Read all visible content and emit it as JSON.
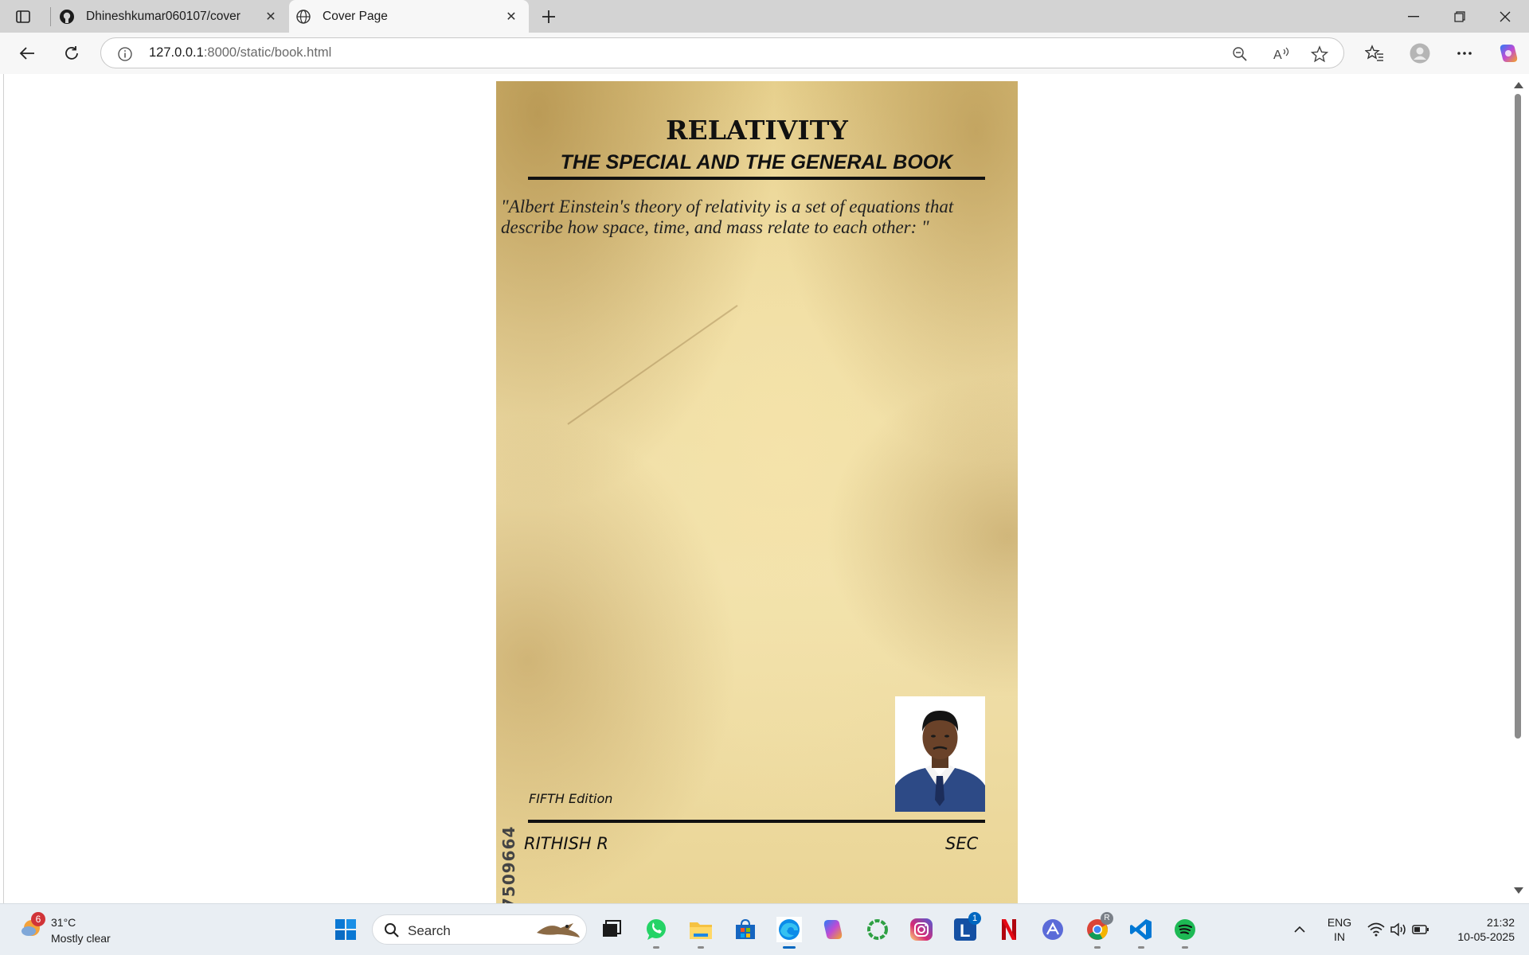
{
  "browser": {
    "tabs": [
      {
        "title": "Dhineshkumar060107/cover",
        "active": false
      },
      {
        "title": "Cover Page",
        "active": true
      }
    ],
    "address": {
      "host": "127.0.0.1",
      "rest": ":8000/static/book.html"
    }
  },
  "book": {
    "title": "RELATIVITY",
    "subtitle": "THE SPECIAL AND THE GENERAL BOOK",
    "quote": "\"Albert Einstein's theory of relativity is a set of equations that describe how space, time, and mass relate to each other: \"",
    "edition": "FIFTH Edition",
    "author": "RITHISH R",
    "publisher": "SEC",
    "code": "7509664"
  },
  "taskbar": {
    "weather": {
      "badge": "6",
      "temp": "31°C",
      "condition": "Mostly clear"
    },
    "search_label": "Search",
    "apps": [
      "task-view",
      "whatsapp",
      "file-explorer",
      "microsoft-store",
      "edge",
      "copilot",
      "app-green-ring",
      "instagram",
      "app-l",
      "netflix",
      "app-triangle",
      "chrome",
      "vscode",
      "spotify"
    ],
    "app_l_badge": "1",
    "language": {
      "line1": "ENG",
      "line2": "IN"
    },
    "clock": {
      "time": "21:32",
      "date": "10-05-2025"
    }
  },
  "colors": {
    "accent_blue": "#0067c0",
    "taskbar_bg": "#e9eef3",
    "tabbar_bg": "#d3d3d3",
    "paper": "#efdca3"
  }
}
